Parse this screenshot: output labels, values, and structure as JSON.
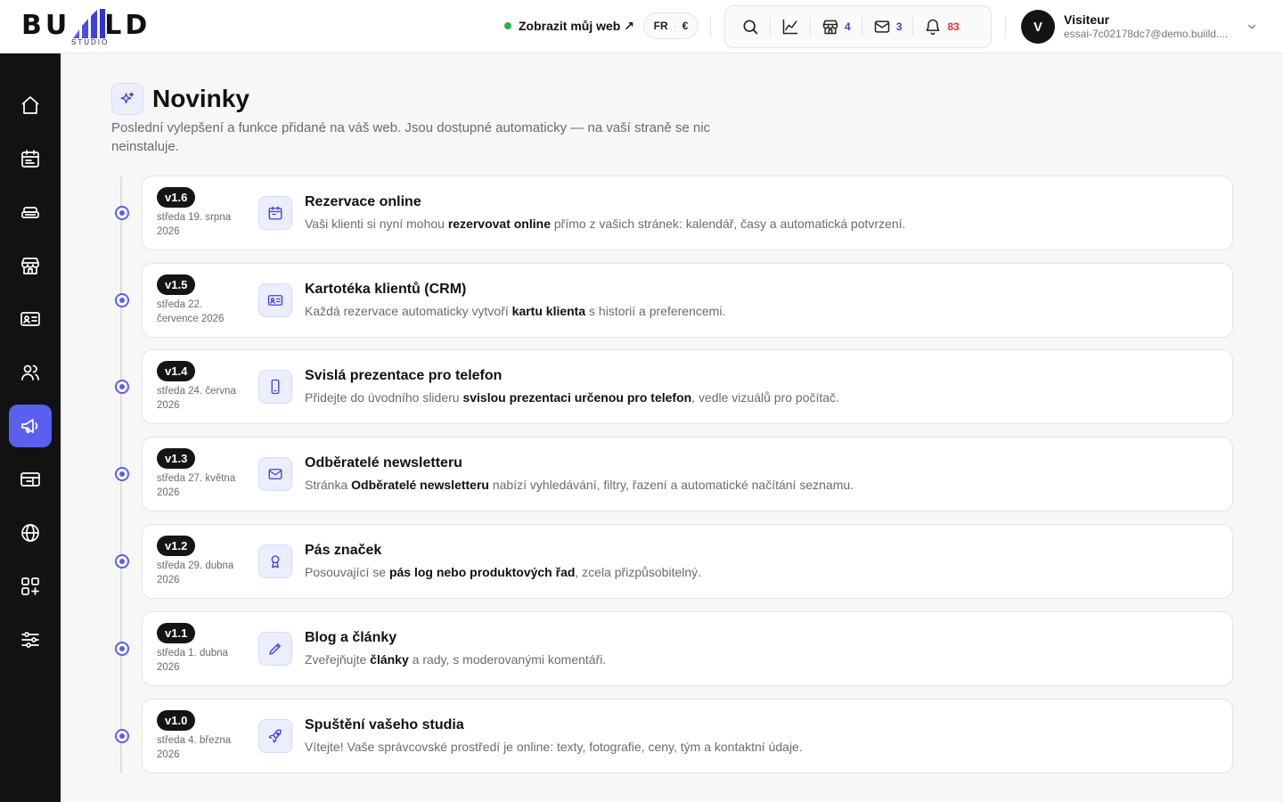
{
  "brand": {
    "logo_text": "BU LD",
    "logo_sub": "STUDIO"
  },
  "header": {
    "view_site": "Zobrazit můj web ↗",
    "lang": "FR",
    "currency": "€",
    "counts": {
      "shops": "4",
      "mail": "3",
      "notifications": "83"
    },
    "user": {
      "initial": "V",
      "name": "Visiteur",
      "email": "essai-7c02178dc7@demo.buiild...."
    }
  },
  "colors": {
    "accent": "#5b5ff0",
    "sidebar_bg": "#121212",
    "badge_bg": "#151515",
    "notify_red": "#e0343a"
  },
  "sidebar": {
    "items": [
      {
        "name": "home-icon"
      },
      {
        "name": "calendar-icon"
      },
      {
        "name": "services-icon"
      },
      {
        "name": "store-icon"
      },
      {
        "name": "id-card-icon"
      },
      {
        "name": "users-icon"
      },
      {
        "name": "megaphone-icon",
        "active": true
      },
      {
        "name": "ticket-icon"
      },
      {
        "name": "globe-icon"
      },
      {
        "name": "apps-icon"
      },
      {
        "name": "sliders-icon"
      }
    ]
  },
  "main": {
    "title": "Novinky",
    "description": "Poslední vylepšení a funkce přidané na váš web. Jsou dostupné automaticky — na vaší straně se nic neinstaluje."
  },
  "entries": [
    {
      "version": "v1.6",
      "date": "středa 19. srpna 2026",
      "icon": "calendar-icon",
      "title": "Rezervace online",
      "desc_before": "Vaši klienti si nyní mohou ",
      "desc_bold": "rezervovat online",
      "desc_after": " přímo z vašich stránek: kalendář, časy a automatická potvrzení."
    },
    {
      "version": "v1.5",
      "date": "středa 22. července 2026",
      "icon": "id-card-icon",
      "title": "Kartotéka klientů (CRM)",
      "desc_before": "Každá rezervace automaticky vytvoří ",
      "desc_bold": "kartu klienta",
      "desc_after": " s historií a preferencemi."
    },
    {
      "version": "v1.4",
      "date": "středa 24. června 2026",
      "icon": "phone-icon",
      "title": "Svislá prezentace pro telefon",
      "desc_before": "Přidejte do úvodního slideru ",
      "desc_bold": "svislou prezentaci určenou pro telefon",
      "desc_after": ", vedle vizuálů pro počítač."
    },
    {
      "version": "v1.3",
      "date": "středa 27. května 2026",
      "icon": "mail-icon",
      "title": "Odběratelé newsletteru",
      "desc_before": "Stránka ",
      "desc_bold": "Odběratelé newsletteru",
      "desc_after": " nabízí vyhledávání, filtry, řazení a automatické načítání seznamu."
    },
    {
      "version": "v1.2",
      "date": "středa 29. dubna 2026",
      "icon": "award-icon",
      "title": "Pás značek",
      "desc_before": "Posouvající se ",
      "desc_bold": "pás log nebo produktových řad",
      "desc_after": ", zcela přizpůsobitelný."
    },
    {
      "version": "v1.1",
      "date": "středa 1. dubna 2026",
      "icon": "pencil-icon",
      "title": "Blog a články",
      "desc_before": "Zveřejňujte ",
      "desc_bold": "články",
      "desc_after": " a rady, s moderovanými komentáři."
    },
    {
      "version": "v1.0",
      "date": "středa 4. března 2026",
      "icon": "rocket-icon",
      "title": "Spuštění vašeho studia",
      "desc_before": "Vítejte! Vaše správcovské prostředí je online: texty, fotografie, ceny, tým a kontaktní údaje.",
      "desc_bold": "",
      "desc_after": ""
    }
  ]
}
